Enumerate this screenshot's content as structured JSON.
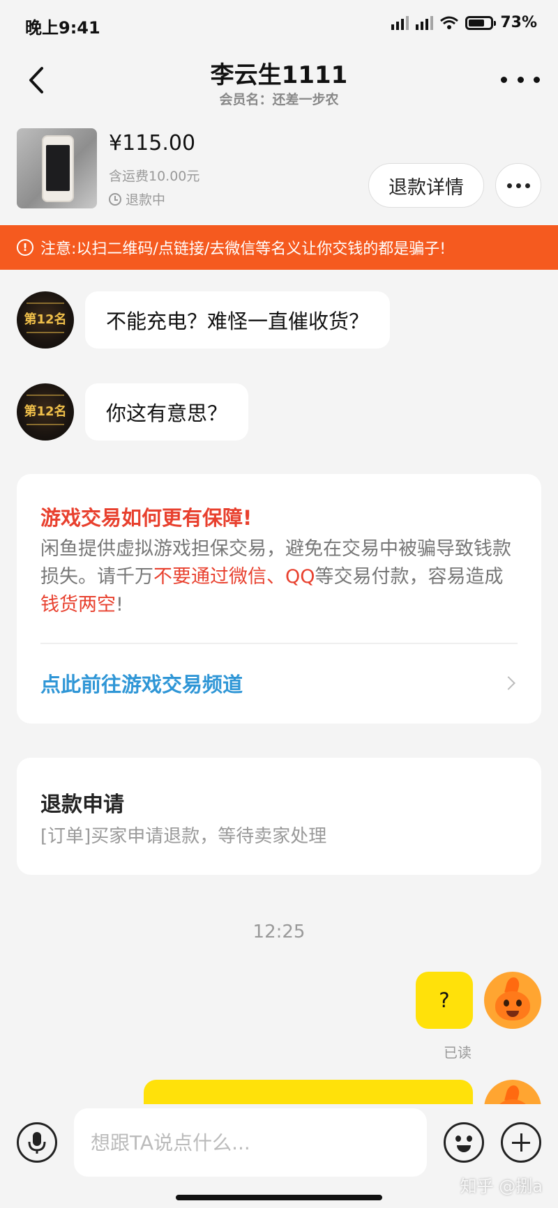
{
  "status_bar": {
    "time": "晚上9:41",
    "battery": "73%",
    "battery_level": 0.73
  },
  "header": {
    "title": "李云生1111",
    "subtitle": "会员名：还差一步农"
  },
  "order": {
    "price": "¥115.00",
    "shipping": "含运费10.00元",
    "status": "退款中",
    "refund_detail_label": "退款详情"
  },
  "warning": {
    "text": "注意:以扫二维码/点链接/去微信等名义让你交钱的都是骗子!"
  },
  "avatar_badge": {
    "text": "第12名"
  },
  "messages_in": [
    {
      "text": "不能充电？难怪一直催收货？"
    },
    {
      "text": "你这有意思？"
    }
  ],
  "guarantee_card": {
    "title": "游戏交易如何更有保障!",
    "body_1": "闲鱼提供虚拟游戏担保交易，避免在交易中被骗导致钱款损失。请千万",
    "body_red_1": "不要通过微信、QQ",
    "body_2": "等交易付款，容易造成",
    "body_red_2": "钱货两空",
    "body_3": "!",
    "link_text": "点此前往游戏交易频道"
  },
  "refund_card": {
    "title": "退款申请",
    "body": "[订单]买家申请退款，等待卖家处理"
  },
  "timestamp": "12:25",
  "messages_out": [
    {
      "text": "?",
      "read_label": "已读"
    }
  ],
  "input": {
    "placeholder": "想跟TA说点什么..."
  },
  "watermark": "知乎 @捌a",
  "colors": {
    "warning_bg": "#f55a1f",
    "accent_red": "#e8402e",
    "link_blue": "#2f96d6",
    "bubble_yellow": "#ffe10a",
    "background": "#f4f4f4"
  }
}
